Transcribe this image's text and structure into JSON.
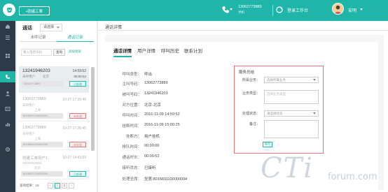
{
  "header": {
    "status_label": "•就緒工單",
    "phone_number": "13062773889",
    "phone_type": "手机",
    "workbench_label": "登录工作台",
    "user_name": "安明"
  },
  "sidebar": {
    "items": [
      "home-icon",
      "list-icon",
      "grid-icon",
      "phone-icon",
      "user-icon",
      "ticket-icon",
      "chart-icon",
      "settings-icon"
    ]
  },
  "left_panel": {
    "title": "通话",
    "filter_select": "请选择",
    "tabs": [
      "未呼记录",
      "通话记录"
    ],
    "search_placeholder": "输入电话号码",
    "query_button": "查询",
    "advanced_search": "高级搜索",
    "records": [
      {
        "phone": "13241946203",
        "time": "14:59:52",
        "status": "未呼用户",
        "city": "北京",
        "duration": "00:00:52",
        "id": "13062773889",
        "badge": "已处理",
        "badge_type": "done"
      },
      {
        "phone": "13062773889",
        "time": "10-27 17:26:46",
        "status": "未呼用户",
        "city": "上海",
        "duration": "",
        "id": "8016831100000004",
        "badge": "未处理",
        "badge_type": "todo"
      },
      {
        "phone": "13062773889",
        "time": "10-27 17:26:45",
        "status": "未呼用户",
        "city": "上海",
        "duration": "",
        "id": "8016831100000004",
        "badge": "未处理",
        "badge_type": "todo"
      },
      {
        "phone": "创建工单用户1",
        "time": "10-27 14:43:59",
        "status": "10310052963",
        "city": "北京",
        "duration": "",
        "id": "8016831100000004",
        "badge": "已处理",
        "badge_type": "done"
      }
    ],
    "pager": {
      "prefix": "查询结果：19",
      "page1": "1",
      "page2": "2"
    }
  },
  "main": {
    "title": "通话详情",
    "tabs": [
      "通话详情",
      "用户详情",
      "呼叫历史",
      "联系计划"
    ],
    "fields": [
      {
        "label": "呼叫类型：",
        "value": "呼出"
      },
      {
        "label": "主叫号码：",
        "value": "13062773889"
      },
      {
        "label": "被叫号码：",
        "value": "13241946203"
      },
      {
        "label": "对方位置：",
        "value": "北京-北京"
      },
      {
        "label": "呼叫时间：",
        "value": "2016-11-09 14:59:52"
      },
      {
        "label": "挂断时间：",
        "value": "2016-11-09 15:00:25"
      },
      {
        "label": "挂断方：",
        "value": "用户挂机"
      },
      {
        "label": "排队时间：",
        "value": "00:00:00"
      },
      {
        "label": "通话时长：",
        "value": "00:00:52"
      },
      {
        "label": "接听状态：",
        "value": "已接听"
      },
      {
        "label": "处理坐席：",
        "value": "坐席:8016831100000004"
      }
    ],
    "service": {
      "title": "服务总结",
      "business_label": "所属业务：",
      "business_placeholder": "选择所属业务",
      "business_type_label": "业务类型：",
      "business_type_placeholder": "选择业务类型",
      "process_state_label": "处理状态：",
      "process_state_placeholder": "请选择状态",
      "remark_label": "备注：",
      "save_button": "保存"
    }
  },
  "watermark": {
    "big": "CTi",
    "small": "forum.com"
  }
}
